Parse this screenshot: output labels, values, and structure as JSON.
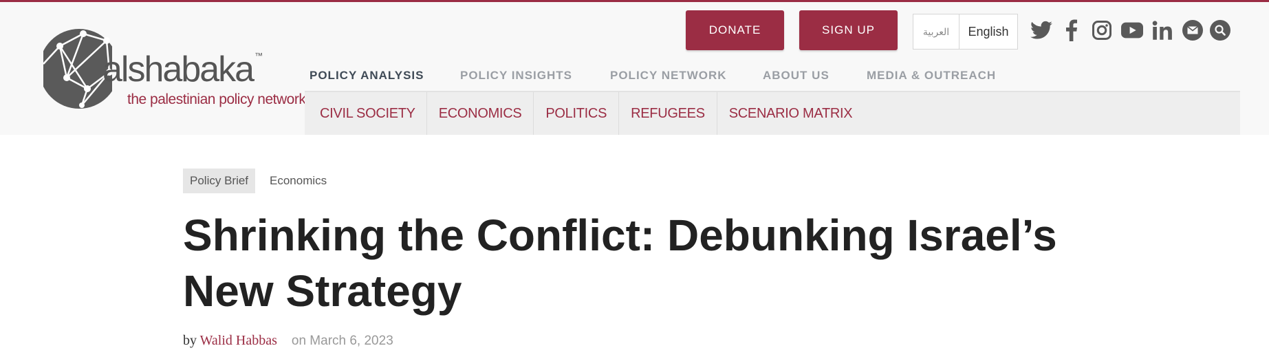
{
  "brand": {
    "wordmark": "alshabaka",
    "trademark": "™",
    "tagline": "the palestinian policy network"
  },
  "colors": {
    "accent": "#9b2d44",
    "nav_active": "#3f4a56",
    "nav_inactive": "#9a9ea4",
    "social_icon": "#595959"
  },
  "header": {
    "donate_label": "DONATE",
    "signup_label": "SIGN UP",
    "languages": {
      "arabic": "العربية",
      "english": "English"
    },
    "social_icons": [
      "twitter-icon",
      "facebook-icon",
      "instagram-icon",
      "youtube-icon",
      "linkedin-icon",
      "email-icon",
      "search-icon"
    ]
  },
  "main_nav": [
    {
      "label": "POLICY ANALYSIS",
      "active": true
    },
    {
      "label": "POLICY INSIGHTS",
      "active": false
    },
    {
      "label": "POLICY NETWORK",
      "active": false
    },
    {
      "label": "ABOUT US",
      "active": false
    },
    {
      "label": "MEDIA & OUTREACH",
      "active": false
    }
  ],
  "sub_nav": [
    {
      "label": "CIVIL SOCIETY"
    },
    {
      "label": "ECONOMICS"
    },
    {
      "label": "POLITICS"
    },
    {
      "label": "REFUGEES"
    },
    {
      "label": "SCENARIO MATRIX"
    }
  ],
  "article": {
    "type_tag": "Policy Brief",
    "category_tag": "Economics",
    "title": "Shrinking the Conflict: Debunking Israel’s New Strategy",
    "by": "by",
    "author": "Walid Habbas",
    "date": "on March 6, 2023"
  }
}
